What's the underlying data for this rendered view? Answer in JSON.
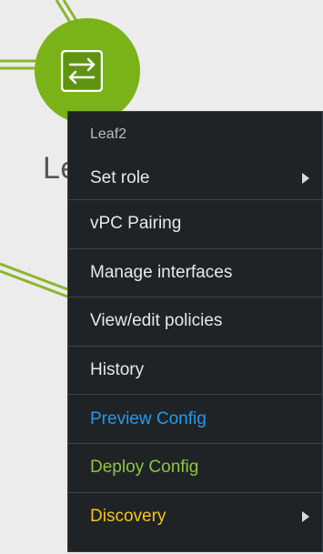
{
  "node": {
    "label_partial": "Le",
    "icon": "switch-arrows-icon",
    "color": "#7ab317"
  },
  "menu": {
    "title": "Leaf2",
    "items": [
      {
        "label": "Set role",
        "submenu": true,
        "color": "#e6e8ea"
      },
      {
        "label": "vPC Pairing",
        "submenu": false,
        "color": "#e6e8ea"
      },
      {
        "label": "Manage interfaces",
        "submenu": false,
        "color": "#e6e8ea"
      },
      {
        "label": "View/edit policies",
        "submenu": false,
        "color": "#e6e8ea"
      },
      {
        "label": "History",
        "submenu": false,
        "color": "#e6e8ea"
      },
      {
        "label": "Preview Config",
        "submenu": false,
        "color": "#1e9bf0"
      },
      {
        "label": "Deploy Config",
        "submenu": false,
        "color": "#8cc63f"
      },
      {
        "label": "Discovery",
        "submenu": true,
        "color": "#f5c518"
      }
    ]
  }
}
